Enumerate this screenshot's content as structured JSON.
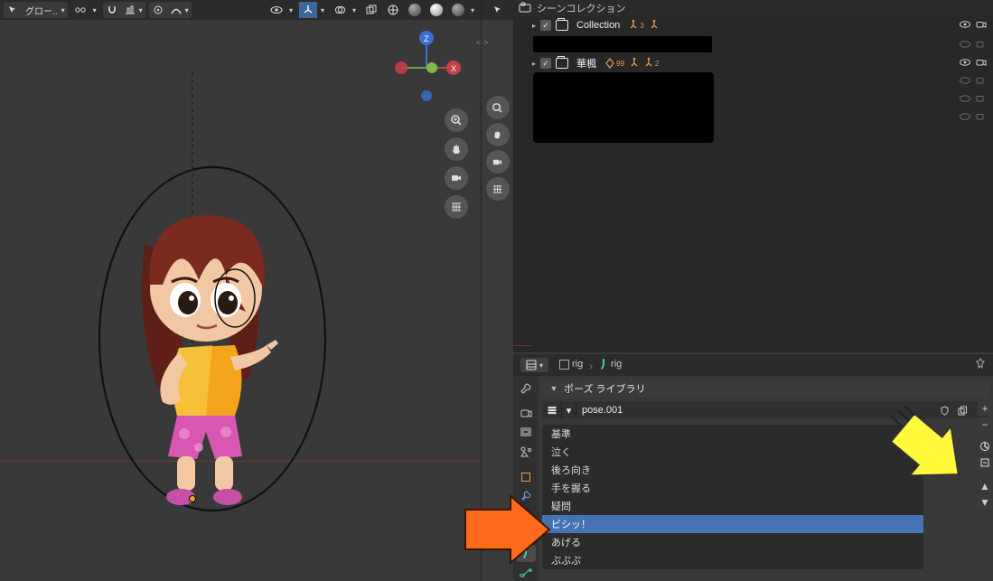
{
  "viewport": {
    "mode_label": "グロー..",
    "snap_label": "",
    "axes": {
      "x": "X",
      "y": "Y",
      "z": "Z"
    }
  },
  "outliner": {
    "title": "シーンコレクション",
    "items": [
      {
        "name": "Collection",
        "badge_a": "3",
        "badge_b": ""
      },
      {
        "name": "華楓",
        "badge_a": "99",
        "badge_b": "2"
      }
    ]
  },
  "properties": {
    "breadcrumb": {
      "a": "rig",
      "b": "rig"
    },
    "panel_title": "ポーズ ライブラリ",
    "pose_datablock": "pose.001",
    "poses": [
      "基準",
      "泣く",
      "後ろ向き",
      "手を握る",
      "疑問",
      "ビシッ！",
      "あげる",
      "ぷぷぷ"
    ],
    "selected_index": 5
  }
}
